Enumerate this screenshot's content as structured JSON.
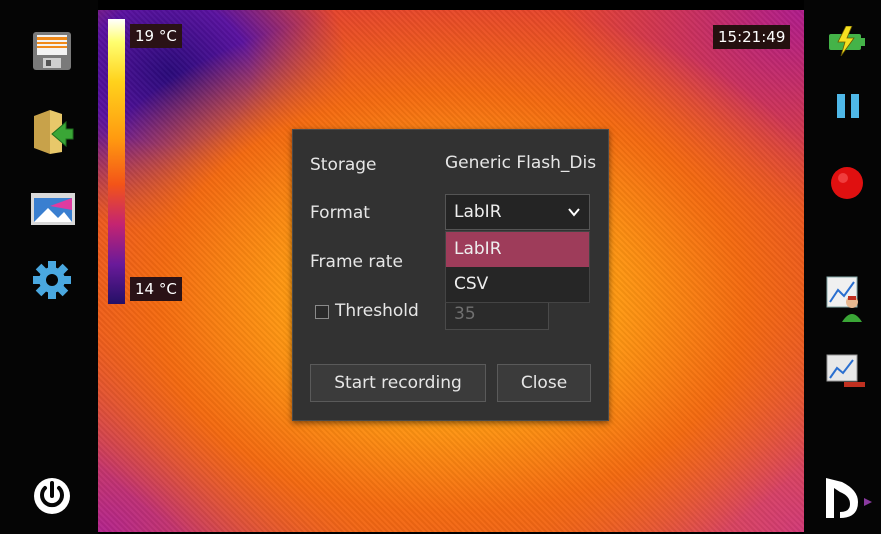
{
  "scale": {
    "max_label": "19 °C",
    "min_label": "14 °C"
  },
  "clock": "15:21:49",
  "dialog": {
    "storage_label": "Storage",
    "storage_value": "Generic Flash_Dis",
    "format_label": "Format",
    "format_selected": "LabIR",
    "format_options": [
      "LabIR",
      "CSV"
    ],
    "framerate_label": "Frame rate",
    "threshold_label": "Threshold",
    "threshold_value": "35",
    "threshold_checked": false,
    "start_button": "Start recording",
    "close_button": "Close"
  },
  "icons": {
    "left": [
      "save-icon",
      "open-folder-icon",
      "image-icon",
      "settings-gear-icon",
      "power-icon"
    ],
    "right": [
      "battery-charging-icon",
      "pause-icon",
      "record-icon",
      "chart-person-icon",
      "chart-icon",
      "logo-icon"
    ]
  },
  "colors": {
    "record": "#e01010",
    "pause": "#4fb8e8",
    "selection": "#9e3c5a",
    "dialog_bg": "#323232"
  }
}
